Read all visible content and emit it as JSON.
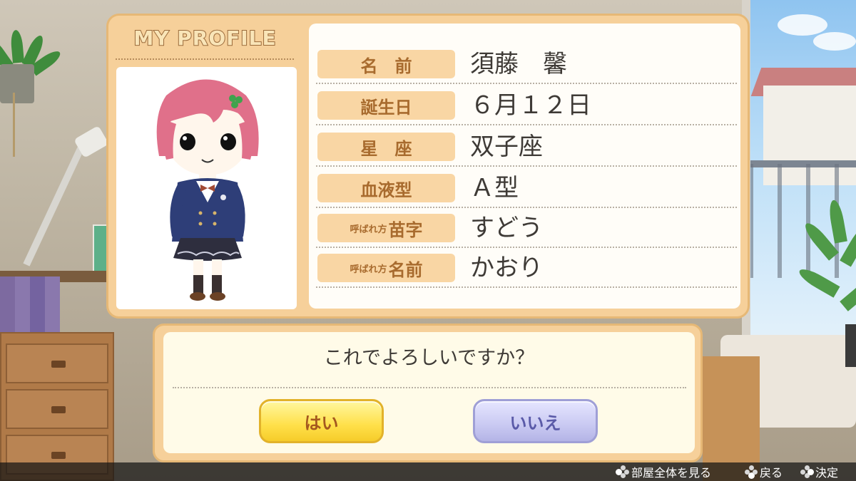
{
  "profile": {
    "title": "MY PROFILE",
    "fields": [
      {
        "label": "名　前",
        "label_small": "",
        "label_big": "",
        "value": "須藤　馨"
      },
      {
        "label": "誕生日",
        "label_small": "",
        "label_big": "",
        "value": "６月１２日"
      },
      {
        "label": "星　座",
        "label_small": "",
        "label_big": "",
        "value": "双子座"
      },
      {
        "label": "血液型",
        "label_small": "",
        "label_big": "",
        "value": "Ａ型"
      },
      {
        "label": "",
        "label_small": "呼ばれ方",
        "label_big": "苗字",
        "value": "すどう"
      },
      {
        "label": "",
        "label_small": "呼ばれ方",
        "label_big": "名前",
        "value": "かおり"
      }
    ]
  },
  "dialog": {
    "question": "これでよろしいですか？",
    "yes_label": "はい",
    "no_label": "いいえ"
  },
  "hints": [
    {
      "icon": "dpad-left-icon",
      "label": "部屋全体を見る"
    },
    {
      "icon": "dpad-bottom-icon",
      "label": "戻る"
    },
    {
      "icon": "dpad-right-icon",
      "label": "決定"
    }
  ],
  "colors": {
    "card": "#f6d09a",
    "label_pill": "#f9d6a4",
    "label_text": "#a86b2e",
    "yes_button": "#ffe04a",
    "no_button": "#c9c9f2"
  }
}
